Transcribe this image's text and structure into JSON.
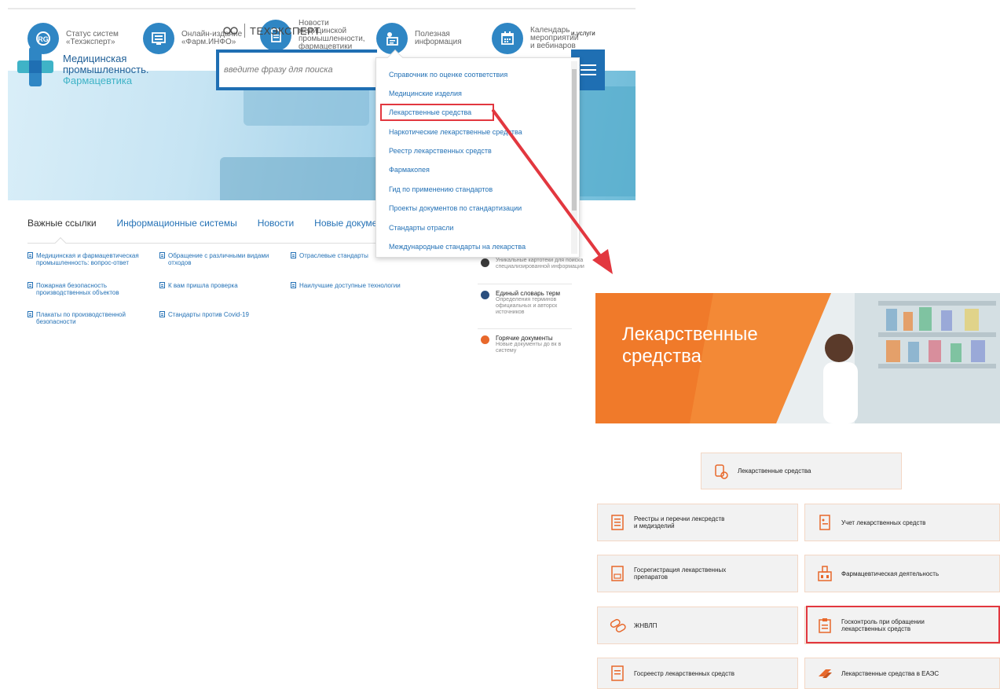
{
  "top_nav": [
    {
      "label": "Статус систем\n«Техэксперт»",
      "icon": "rg-icon"
    },
    {
      "label": "Онлайн-издание\n«Фарм.ИНФО»",
      "icon": "monitor-icon"
    },
    {
      "label": "Новости\nмедицинской\nпромышленности,\nфармацевтики",
      "icon": "document-icon"
    },
    {
      "label": "Полезная\nинформация",
      "icon": "info-icon"
    },
    {
      "label": "Календарь\nмероприятий\nи вебинаров",
      "icon": "calendar-icon"
    }
  ],
  "logo": {
    "line1": "Медицинская",
    "line2": "промышленность.",
    "line3": "Фармацевтика"
  },
  "techexpert_brand": "ТЕХЭКСПЕРТ",
  "services_label": "и услуги",
  "search": {
    "placeholder": "введите фразу для поиска"
  },
  "tabs": [
    "Важные ссылки",
    "Информационные системы",
    "Новости",
    "Новые докумен"
  ],
  "links": [
    {
      "text": "Медицинская и фармацевтическая промышленность: вопрос-ответ"
    },
    {
      "text": "Обращение с различными видами отходов"
    },
    {
      "text": "Отраслевые стандарты"
    },
    {
      "text": "Пожарная безопасность производственных объектов"
    },
    {
      "text": "К вам пришла проверка"
    },
    {
      "text": "Наилучшие доступные технологии"
    },
    {
      "text": "Плакаты по производственной безопасности"
    },
    {
      "text": "Стандарты против Covid-19"
    }
  ],
  "side_list": [
    {
      "title": "",
      "desc": "Уникальные картотеки для поиска специализированной информации",
      "color": "#3a3a3a"
    },
    {
      "title": "Единый словарь терм",
      "desc": "Определения терминов официальных и авторск источников",
      "color": "#2b4f7e"
    },
    {
      "title": "Горячие документы",
      "desc": "Новые документы до вк в систему",
      "color": "#e8682b"
    }
  ],
  "dropdown_items": [
    "Справочник по оценке соответствия",
    "Медицинские изделия",
    "Лекарственные средства",
    "Наркотические лекарственные средства",
    "Реестр лекарственных средств",
    "Фармакопея",
    "Гид по применению стандартов",
    "Проекты документов по стандартизации",
    "Стандарты отрасли",
    "Международные стандарты на лекарства"
  ],
  "dropdown_selected_index": 2,
  "orange_panel": {
    "title": "Лекарственные\nсредства",
    "color": "#f07a2a"
  },
  "main_card": "Лекарственные средства",
  "cards": [
    "Реестры и перечни лексредств\nи медизделий",
    "Учет лекарственных средств",
    "Госрегистрация лекарственных\nпрепаратов",
    "Фармацевтическая деятельность",
    "ЖНВЛП",
    "Госконтроль при обращении\nлекарственных средств",
    "Госреестр лекарственных средств",
    "Лекарственные средства в ЕАЭС"
  ],
  "colors": {
    "brand_blue": "#2f86c4",
    "link_blue": "#2572b6",
    "highlight_red": "#e2373f",
    "accent_orange": "#f07a2a"
  }
}
